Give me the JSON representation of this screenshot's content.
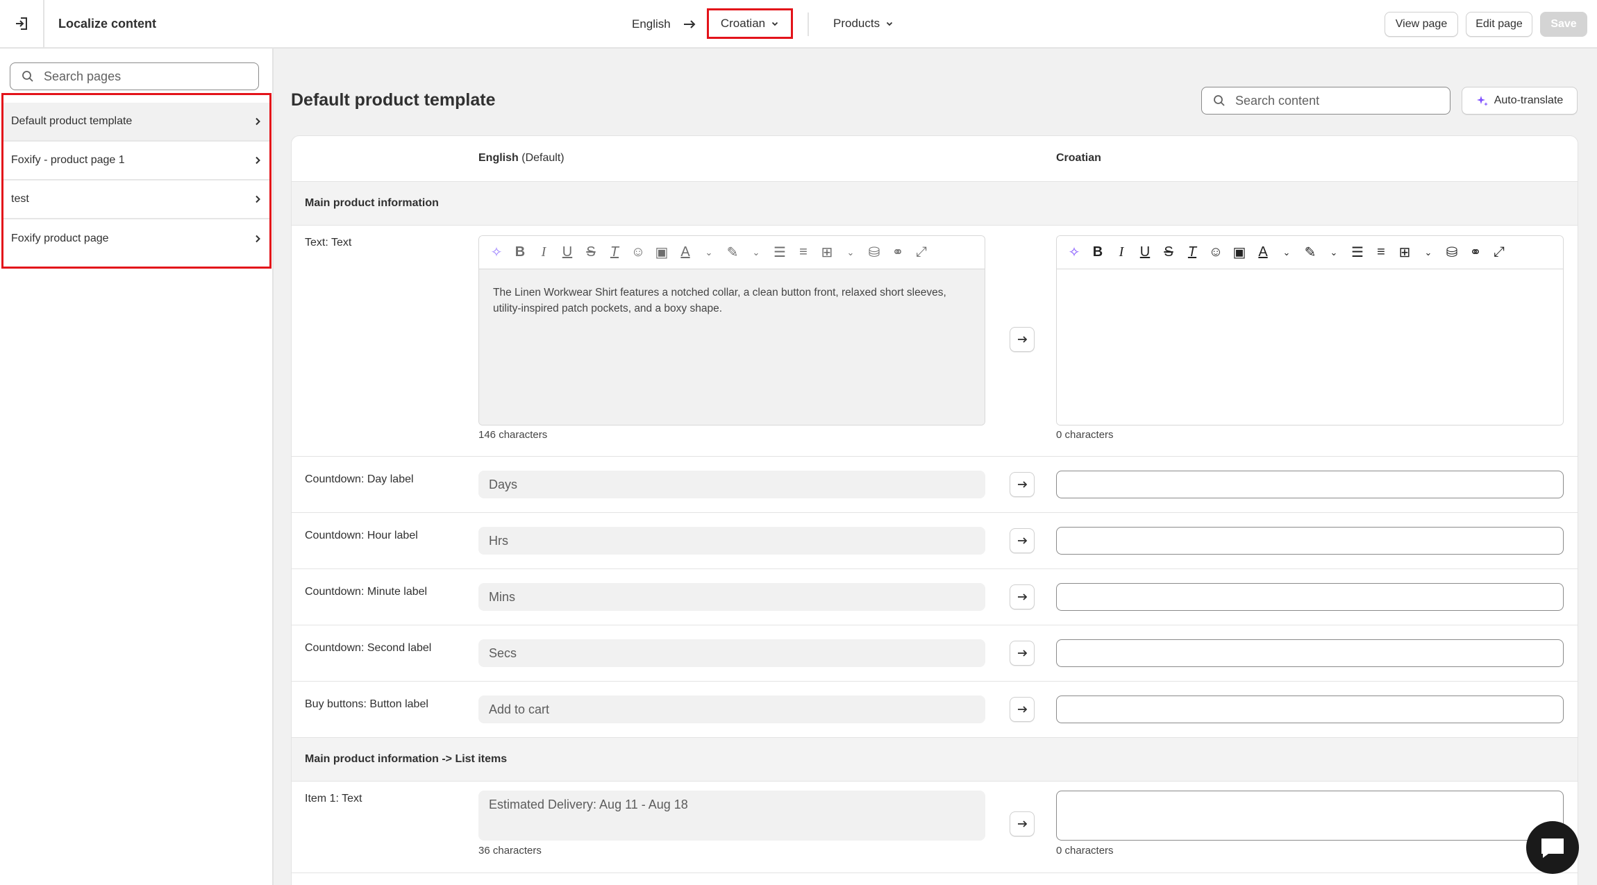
{
  "header": {
    "title": "Localize content",
    "source_language": "English",
    "target_language": "Croatian",
    "resource_type": "Products",
    "view_page": "View page",
    "edit_page": "Edit page",
    "save": "Save"
  },
  "sidebar": {
    "search_placeholder": "Search pages",
    "items": [
      {
        "label": "Default product template",
        "active": true
      },
      {
        "label": "Foxify - product page 1",
        "active": false
      },
      {
        "label": "test",
        "active": false
      },
      {
        "label": "Foxify product page",
        "active": false
      }
    ]
  },
  "main": {
    "title": "Default product template",
    "search_placeholder": "Search content",
    "auto_translate": "Auto-translate",
    "columns": {
      "source_name": "English",
      "source_suffix": "(Default)",
      "target_name": "Croatian"
    },
    "sections": [
      {
        "title": "Main product information"
      },
      {
        "title": "Main product information -> List items"
      }
    ],
    "rich_text": {
      "label": "Text: Text",
      "source_text": "The Linen Workwear Shirt features a notched collar, a clean button front, relaxed short sleeves, utility-inspired patch pockets, and a boxy shape.",
      "source_count": "146 characters",
      "target_count": "0 characters"
    },
    "fields": [
      {
        "label": "Countdown: Day label",
        "source": "Days"
      },
      {
        "label": "Countdown: Hour label",
        "source": "Hrs"
      },
      {
        "label": "Countdown: Minute label",
        "source": "Mins"
      },
      {
        "label": "Countdown: Second label",
        "source": "Secs"
      },
      {
        "label": "Buy buttons: Button label",
        "source": "Add to cart"
      }
    ],
    "list_item": {
      "label": "Item 1: Text",
      "source": "Estimated Delivery:  Aug 11 - Aug 18",
      "source_count": "36 characters",
      "target_count": "0 characters"
    }
  },
  "colors": {
    "highlight_border": "#e3131a",
    "ai_accent": "#8051ff",
    "background": "#f1f1f1"
  }
}
